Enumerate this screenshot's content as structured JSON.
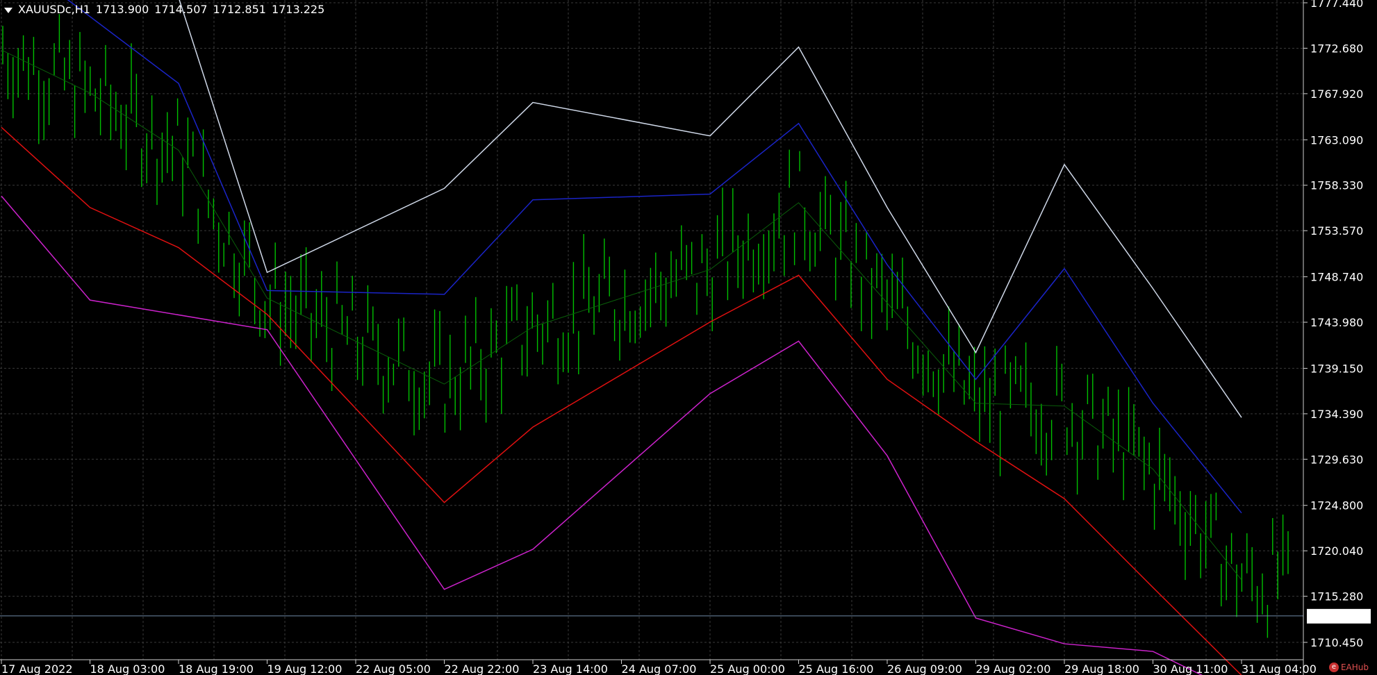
{
  "header": {
    "symbol": "XAUUSDc,H1",
    "open": "1713.900",
    "high": "1714.507",
    "low": "1712.851",
    "close": "1713.225"
  },
  "logo_text": "EAHub",
  "colors": {
    "background": "#000000",
    "grid": "#3a3a3a",
    "candles": "#00c000",
    "price_line": "#6f8aa8",
    "price_label_bg": "#ffffff",
    "axis_text": "#ffffff"
  },
  "chart_data": {
    "type": "line",
    "title": "XAUUSDc,H1",
    "ylim": [
      1708.0,
      1777.44
    ],
    "y_ticks": [
      "1777.440",
      "1772.680",
      "1767.920",
      "1763.090",
      "1758.330",
      "1753.570",
      "1748.740",
      "1743.980",
      "1739.150",
      "1734.390",
      "1729.630",
      "1724.800",
      "1720.040",
      "1715.280",
      "1710.450"
    ],
    "x_ticks": [
      "17 Aug 2022",
      "18 Aug 03:00",
      "18 Aug 19:00",
      "19 Aug 12:00",
      "22 Aug 05:00",
      "22 Aug 22:00",
      "23 Aug 14:00",
      "24 Aug 07:00",
      "25 Aug 00:00",
      "25 Aug 16:00",
      "26 Aug 09:00",
      "29 Aug 02:00",
      "29 Aug 18:00",
      "30 Aug 11:00",
      "31 Aug 04:00"
    ],
    "current_price": "1713.225",
    "series": [
      {
        "color": "#cfd8e8",
        "x": [
          "17 Aug 2022",
          "18 Aug 19:00",
          "19 Aug 12:00",
          "22 Aug 22:00",
          "23 Aug 14:00",
          "25 Aug 00:00",
          "25 Aug 16:00",
          "26 Aug 09:00",
          "29 Aug 02:00",
          "29 Aug 18:00",
          "30 Aug 11:00",
          "31 Aug 04:00"
        ],
        "values": [
          1790,
          1778,
          1749.2,
          1758.0,
          1767.0,
          1763.5,
          1772.8,
          1756.0,
          1740.8,
          1760.5,
          1747.5,
          1734.0
        ]
      },
      {
        "color": "#1a24c8",
        "x": [
          "17 Aug 2022",
          "18 Aug 19:00",
          "19 Aug 12:00",
          "22 Aug 22:00",
          "23 Aug 14:00",
          "25 Aug 00:00",
          "25 Aug 16:00",
          "26 Aug 09:00",
          "29 Aug 02:00",
          "29 Aug 18:00",
          "30 Aug 11:00",
          "31 Aug 04:00"
        ],
        "values": [
          1783,
          1769.0,
          1747.3,
          1746.9,
          1756.8,
          1757.4,
          1764.8,
          1750.0,
          1738.0,
          1749.6,
          1735.5,
          1724.0
        ]
      },
      {
        "color": "#e01010",
        "x": [
          "17 Aug 2022",
          "18 Aug 03:00",
          "18 Aug 19:00",
          "19 Aug 12:00",
          "22 Aug 22:00",
          "23 Aug 14:00",
          "25 Aug 00:00",
          "25 Aug 16:00",
          "26 Aug 09:00",
          "29 Aug 02:00",
          "29 Aug 18:00",
          "30 Aug 11:00",
          "31 Aug 04:00"
        ],
        "values": [
          1764.4,
          1756.0,
          1751.8,
          1744.8,
          1725.1,
          1733.0,
          1744.0,
          1748.9,
          1738.0,
          1731.5,
          1725.5,
          1716.2,
          1707.0
        ]
      },
      {
        "color": "#cc22cc",
        "x": [
          "17 Aug 2022",
          "18 Aug 03:00",
          "19 Aug 12:00",
          "22 Aug 22:00",
          "23 Aug 14:00",
          "25 Aug 00:00",
          "25 Aug 16:00",
          "26 Aug 09:00",
          "29 Aug 02:00",
          "29 Aug 18:00",
          "30 Aug 11:00",
          "31 Aug 04:00"
        ],
        "values": [
          1757.2,
          1746.3,
          1743.2,
          1716.0,
          1720.2,
          1736.5,
          1742.0,
          1730.0,
          1713.0,
          1710.3,
          1709.5,
          1705.0
        ]
      },
      {
        "color": "#0a5e0a",
        "x": [
          "17 Aug 2022",
          "18 Aug 03:00",
          "18 Aug 19:00",
          "19 Aug 12:00",
          "22 Aug 05:00",
          "22 Aug 22:00",
          "23 Aug 14:00",
          "24 Aug 07:00",
          "25 Aug 00:00",
          "25 Aug 16:00",
          "26 Aug 09:00",
          "29 Aug 02:00",
          "29 Aug 18:00",
          "30 Aug 11:00",
          "31 Aug 04:00"
        ],
        "values": [
          1772.5,
          1768.0,
          1762.0,
          1746.5,
          1742.0,
          1737.5,
          1743.5,
          1746.5,
          1749.5,
          1756.5,
          1746.0,
          1735.5,
          1735.2,
          1728.6,
          1717.0
        ]
      }
    ]
  }
}
